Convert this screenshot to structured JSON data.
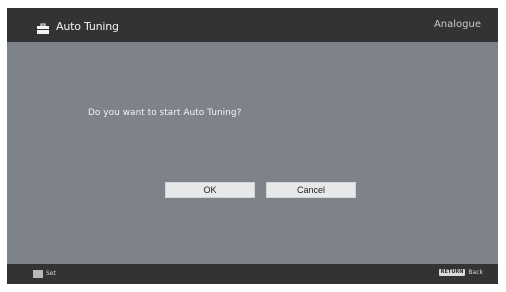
{
  "header": {
    "title": "Auto Tuning",
    "mode": "Analogue",
    "icon": "toolbox-icon"
  },
  "dialog": {
    "question": "Do you want to start Auto Tuning?",
    "ok_label": "OK",
    "cancel_label": "Cancel"
  },
  "footer": {
    "set_label": "Set",
    "return_key": "RETURN",
    "back_label": "Back"
  },
  "colors": {
    "background": "#7d8389",
    "header_bar": "#333335",
    "button": "#e7e8e9"
  }
}
